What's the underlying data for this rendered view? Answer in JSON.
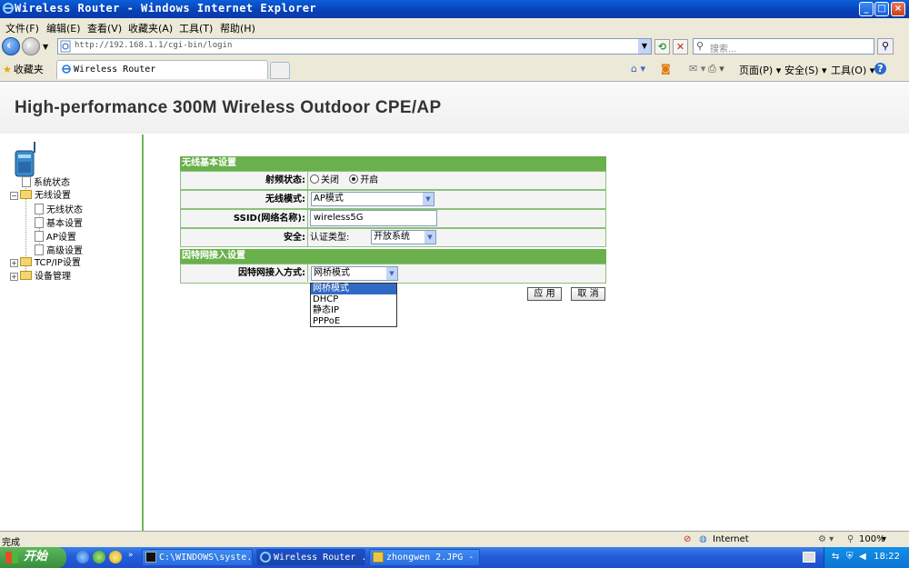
{
  "window": {
    "title": "Wireless Router - Windows Internet Explorer",
    "btn_min": "_",
    "btn_max": "□",
    "btn_close": "×"
  },
  "menu": [
    "文件(F)",
    "编辑(E)",
    "查看(V)",
    "收藏夹(A)",
    "工具(T)",
    "帮助(H)"
  ],
  "address": {
    "url": "http://192.168.1.1/cgi-bin/login",
    "search_placeholder": "搜索..."
  },
  "favorites_label": "收藏夹",
  "tab_title": "Wireless Router",
  "commands": {
    "page": "页面(P) ▾",
    "safety": "安全(S) ▾",
    "tools": "工具(O) ▾",
    "help": "?"
  },
  "header_title": "High-performance 300M Wireless Outdoor CPE/AP",
  "tree": {
    "status": "系统状态",
    "wireless": "无线设置",
    "w_status": "无线状态",
    "w_basic": "基本设置",
    "w_ap": "AP设置",
    "w_advanced": "高级设置",
    "tcpip": "TCP/IP设置",
    "device": "设备管理"
  },
  "form": {
    "section1": "无线基本设置",
    "radio_label": "射频状态:",
    "radio_off": "关闭",
    "radio_on": "开启",
    "mode_label": "无线模式:",
    "mode_value": "AP模式",
    "ssid_label": "SSID(网络名称):",
    "ssid_value": "wireless5G",
    "security_label": "安全:",
    "auth_label": "认证类型:",
    "auth_value": "开放系统",
    "section2": "因特网接入设置",
    "inet_label": "因特网接入方式:",
    "inet_value": "网桥模式",
    "inet_options": [
      "网桥模式",
      "DHCP",
      "静态IP",
      "PPPoE"
    ],
    "apply": "应 用",
    "cancel": "取 消"
  },
  "status": {
    "left": "完成",
    "zone": "Internet",
    "zoom": "100%"
  },
  "taskbar": {
    "start": "开始",
    "items": [
      "C:\\WINDOWS\\syste...",
      "Wireless Router ...",
      "zhongwen 2.JPG - ..."
    ],
    "clock": "18:22"
  }
}
